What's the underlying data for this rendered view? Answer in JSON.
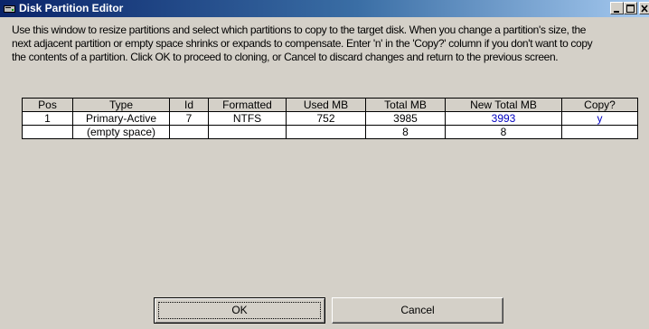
{
  "window": {
    "title": "Disk Partition Editor",
    "icon": "disk-icon",
    "controls": [
      "minimize-icon",
      "maximize-icon",
      "close-icon"
    ]
  },
  "description": {
    "line1": "Use this window to resize partitions and select which partitions to copy to the target disk. When you change a partition's size, the",
    "line2": "next adjacent partition or empty space shrinks or expands to compensate. Enter 'n' in the 'Copy?' column if you don't want to copy",
    "line3": "the contents of a partition. Click OK to proceed to cloning, or Cancel to discard changes and return to the previous screen."
  },
  "table": {
    "columns": [
      "Pos",
      "Type",
      "Id",
      "Formatted",
      "Used MB",
      "Total MB",
      "New Total MB",
      "Copy?"
    ],
    "rows": [
      [
        "1",
        "Primary-Active",
        "7",
        "NTFS",
        "752",
        "3985",
        "3993",
        "y"
      ],
      [
        "",
        "(empty space)",
        "",
        "",
        "",
        "8",
        "8",
        ""
      ]
    ]
  },
  "buttons": {
    "ok": "OK",
    "cancel": "Cancel"
  },
  "colors": {
    "titlebar_start": "#0a246a",
    "titlebar_end": "#a6caf0",
    "editable_text": "#0000c0",
    "window_bg": "#d4d0c8"
  }
}
